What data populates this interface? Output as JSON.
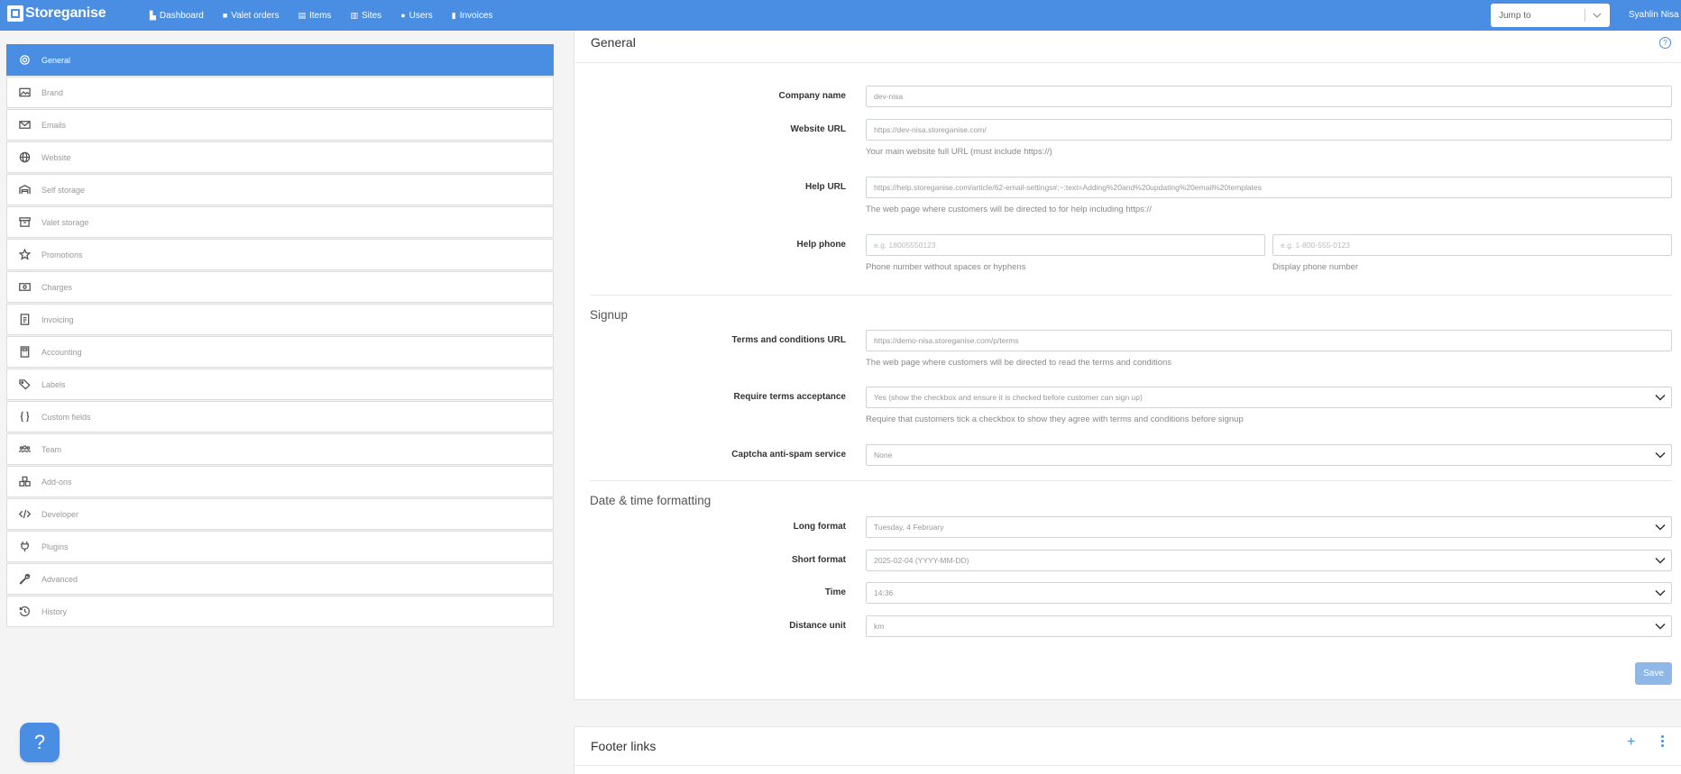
{
  "brand": {
    "name": "Storeganise"
  },
  "nav": [
    {
      "label": "Dashboard",
      "icon": "dashboard-icon"
    },
    {
      "label": "Valet orders",
      "icon": "truck-icon"
    },
    {
      "label": "Items",
      "icon": "box-icon"
    },
    {
      "label": "Sites",
      "icon": "building-icon"
    },
    {
      "label": "Users",
      "icon": "user-icon"
    },
    {
      "label": "Invoices",
      "icon": "file-icon"
    }
  ],
  "jump": {
    "placeholder": "Jump to"
  },
  "user": {
    "name": "Syahlin Nisa"
  },
  "sidebar": {
    "items": [
      {
        "label": "General",
        "icon": "gear-icon",
        "active": true
      },
      {
        "label": "Brand",
        "icon": "image-icon"
      },
      {
        "label": "Emails",
        "icon": "envelope-icon"
      },
      {
        "label": "Website",
        "icon": "globe-icon"
      },
      {
        "label": "Self storage",
        "icon": "warehouse-icon"
      },
      {
        "label": "Valet storage",
        "icon": "archive-icon"
      },
      {
        "label": "Promotions",
        "icon": "star-icon"
      },
      {
        "label": "Charges",
        "icon": "money-icon"
      },
      {
        "label": "Invoicing",
        "icon": "invoice-icon"
      },
      {
        "label": "Accounting",
        "icon": "calculator-icon"
      },
      {
        "label": "Labels",
        "icon": "tags-icon"
      },
      {
        "label": "Custom fields",
        "icon": "braces-icon"
      },
      {
        "label": "Team",
        "icon": "team-icon"
      },
      {
        "label": "Add-ons",
        "icon": "addons-icon"
      },
      {
        "label": "Developer",
        "icon": "code-icon"
      },
      {
        "label": "Plugins",
        "icon": "plug-icon"
      },
      {
        "label": "Advanced",
        "icon": "wrench-icon"
      },
      {
        "label": "History",
        "icon": "history-icon"
      }
    ]
  },
  "general": {
    "title": "General",
    "company_name": {
      "label": "Company name",
      "value": "dev-nisa"
    },
    "website_url": {
      "label": "Website URL",
      "value": "https://dev-nisa.storeganise.com/",
      "help": "Your main website full URL (must include https://)"
    },
    "help_url": {
      "label": "Help URL",
      "value": "https://help.storeganise.com/article/62-email-settings#:~:text=Adding%20and%20updating%20email%20templates",
      "help": "The web page where customers will be directed to for help including https://"
    },
    "help_phone": {
      "label": "Help phone",
      "placeholder1": "e.g. 18005550123",
      "help1": "Phone number without spaces or hyphens",
      "placeholder2": "e.g. 1-800-555-0123",
      "help2": "Display phone number"
    }
  },
  "signup": {
    "title": "Signup",
    "terms_url": {
      "label": "Terms and conditions URL",
      "value": "https://demo-nisa.storeganise.com/p/terms",
      "help": "The web page where customers will be directed to read the terms and conditions"
    },
    "require_terms": {
      "label": "Require terms acceptance",
      "value": "Yes (show the checkbox and ensure it is checked before customer can sign up)",
      "help": "Require that customers tick a checkbox to show they agree with terms and conditions before signup"
    },
    "captcha": {
      "label": "Captcha anti-spam service",
      "value": "None"
    }
  },
  "datetime": {
    "title": "Date & time formatting",
    "long_format": {
      "label": "Long format",
      "value": "Tuesday, 4 February"
    },
    "short_format": {
      "label": "Short format",
      "value": "2025-02-04 (YYYY-MM-DD)"
    },
    "time": {
      "label": "Time",
      "value": "14:36"
    },
    "distance_unit": {
      "label": "Distance unit",
      "value": "km"
    }
  },
  "save_label": "Save",
  "footer_links": {
    "title": "Footer links"
  },
  "help_fab": {
    "label": "?"
  }
}
